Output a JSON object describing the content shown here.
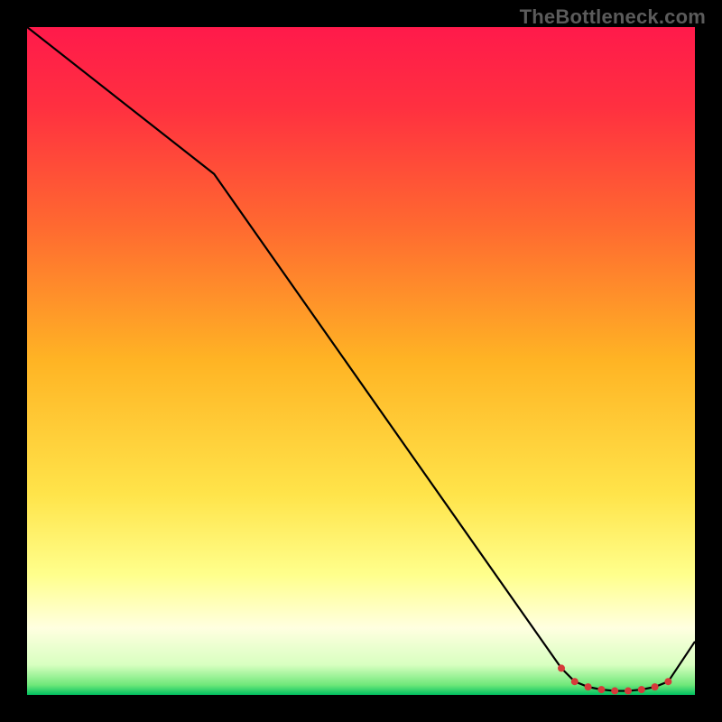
{
  "watermark": "TheBottleneck.com",
  "chart_data": {
    "type": "line",
    "title": "",
    "xlabel": "",
    "ylabel": "",
    "xlim": [
      0,
      100
    ],
    "ylim": [
      0,
      100
    ],
    "background_gradient": {
      "stops": [
        {
          "offset": 0.0,
          "color": "#ff1a4b"
        },
        {
          "offset": 0.12,
          "color": "#ff3040"
        },
        {
          "offset": 0.3,
          "color": "#ff6a30"
        },
        {
          "offset": 0.5,
          "color": "#ffb424"
        },
        {
          "offset": 0.7,
          "color": "#ffe44a"
        },
        {
          "offset": 0.82,
          "color": "#ffff8c"
        },
        {
          "offset": 0.9,
          "color": "#ffffe0"
        },
        {
          "offset": 0.955,
          "color": "#d8ffc0"
        },
        {
          "offset": 0.985,
          "color": "#70e87a"
        },
        {
          "offset": 1.0,
          "color": "#00c060"
        }
      ]
    },
    "series": [
      {
        "name": "bottleneck-curve",
        "color": "#000000",
        "x": [
          0,
          28,
          80,
          82,
          84,
          86,
          88,
          90,
          92,
          94,
          96,
          100
        ],
        "y": [
          100,
          78,
          4,
          2,
          1.2,
          0.8,
          0.6,
          0.6,
          0.8,
          1.2,
          2,
          8
        ]
      }
    ],
    "markers": {
      "name": "highlight-range",
      "color": "#d63a3a",
      "x": [
        80,
        82,
        84,
        86,
        88,
        90,
        92,
        94,
        96
      ],
      "y": [
        4,
        2,
        1.2,
        0.8,
        0.6,
        0.6,
        0.8,
        1.2,
        2
      ]
    }
  }
}
